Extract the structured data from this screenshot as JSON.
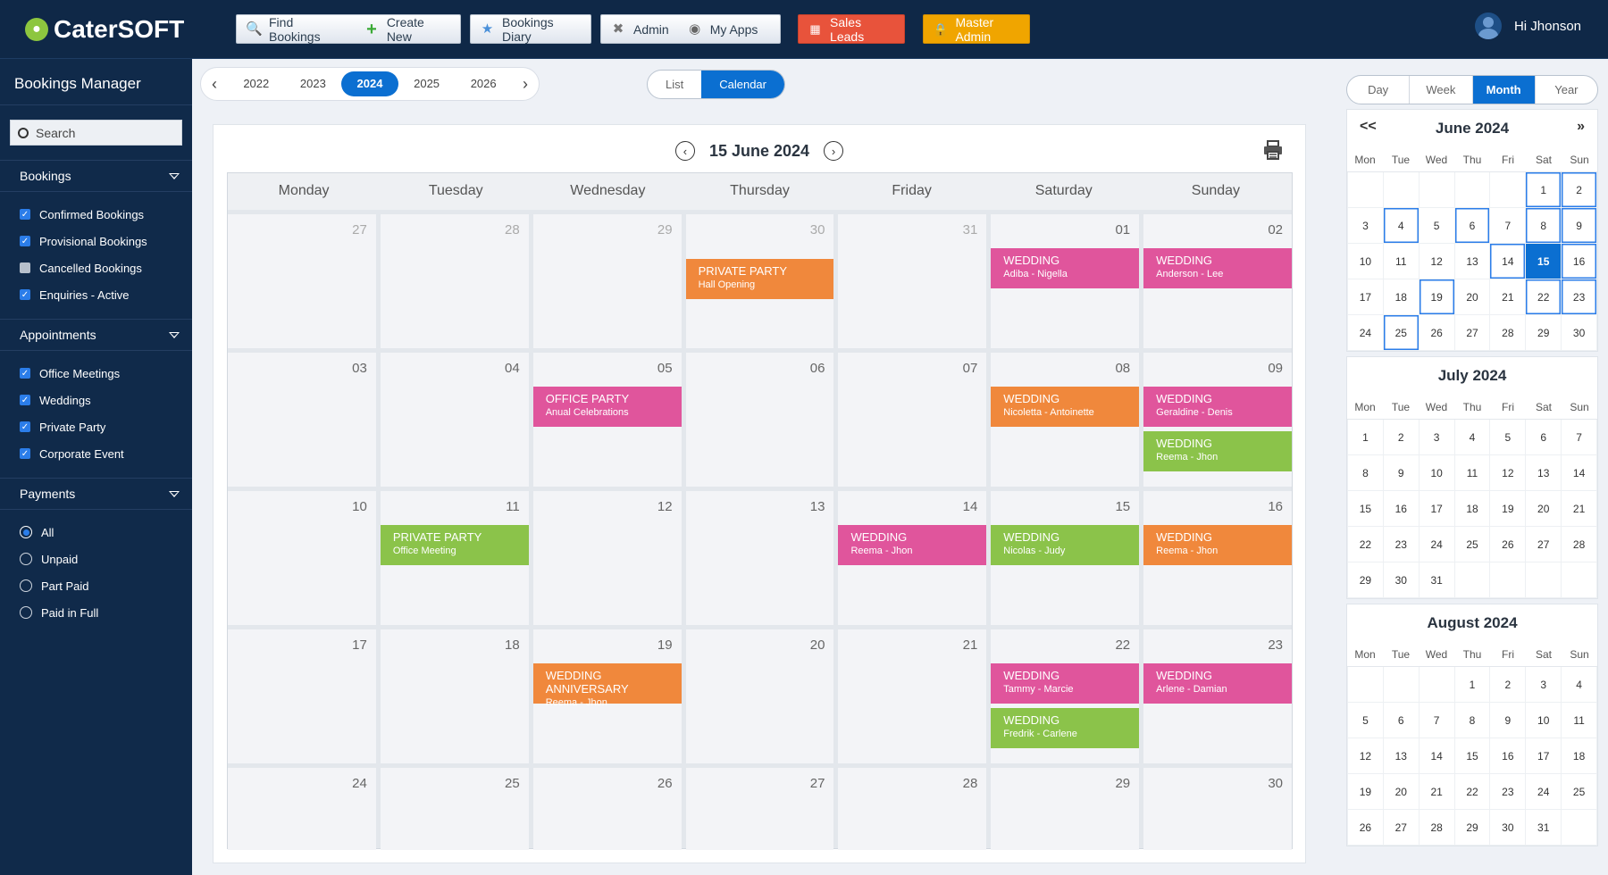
{
  "app": {
    "logo": "CaterSOFT"
  },
  "toolbar": {
    "find": "Find Bookings",
    "create": "Create New",
    "diary": "Bookings Diary",
    "admin": "Admin",
    "apps": "My Apps",
    "sales": "Sales Leads",
    "master": "Master Admin",
    "greeting": "Hi Jhonson"
  },
  "sidebar": {
    "title": "Bookings Manager",
    "search_placeholder": "Search",
    "sections": [
      {
        "label": "Bookings",
        "type": "checkbox",
        "items": [
          {
            "label": "Confirmed Bookings",
            "checked": true
          },
          {
            "label": "Provisional Bookings",
            "checked": true
          },
          {
            "label": "Cancelled Bookings",
            "checked": false
          },
          {
            "label": "Enquiries - Active",
            "checked": true
          }
        ]
      },
      {
        "label": "Appointments",
        "type": "checkbox",
        "items": [
          {
            "label": "Office Meetings",
            "checked": true
          },
          {
            "label": "Weddings",
            "checked": true
          },
          {
            "label": "Private Party",
            "checked": true
          },
          {
            "label": "Corporate Event",
            "checked": true
          }
        ]
      },
      {
        "label": "Payments",
        "type": "radio",
        "items": [
          {
            "label": "All",
            "checked": true
          },
          {
            "label": "Unpaid",
            "checked": false
          },
          {
            "label": "Part Paid",
            "checked": false
          },
          {
            "label": "Paid in Full",
            "checked": false
          }
        ]
      }
    ]
  },
  "years": {
    "list": [
      "2022",
      "2023",
      "2024",
      "2025",
      "2026"
    ],
    "active": "2024"
  },
  "view_toggle": {
    "list": "List",
    "calendar": "Calendar",
    "active": "Calendar"
  },
  "calendar": {
    "title": "15 June 2024",
    "weekdays": [
      "Monday",
      "Tuesday",
      "Wednesday",
      "Thursday",
      "Friday",
      "Saturday",
      "Sunday"
    ],
    "weeks": [
      [
        {
          "day": "27",
          "dim": true,
          "events": []
        },
        {
          "day": "28",
          "dim": true,
          "events": []
        },
        {
          "day": "29",
          "dim": true,
          "events": []
        },
        {
          "day": "30",
          "dim": true,
          "events": [
            {
              "title": "PRIVATE PARTY",
              "sub": "Hall Opening",
              "color": "orange",
              "offset": true
            }
          ]
        },
        {
          "day": "31",
          "dim": true,
          "events": []
        },
        {
          "day": "01",
          "events": [
            {
              "title": "WEDDING",
              "sub": "Adiba  - Nigella",
              "color": "pink"
            }
          ]
        },
        {
          "day": "02",
          "events": [
            {
              "title": "WEDDING",
              "sub": "Anderson - Lee",
              "color": "pink"
            }
          ]
        }
      ],
      [
        {
          "day": "03",
          "events": []
        },
        {
          "day": "04",
          "events": []
        },
        {
          "day": "05",
          "events": [
            {
              "title": "OFFICE PARTY",
              "sub": "Anual Celebrations",
              "color": "pink"
            }
          ]
        },
        {
          "day": "06",
          "events": []
        },
        {
          "day": "07",
          "events": []
        },
        {
          "day": "08",
          "events": [
            {
              "title": "WEDDING",
              "sub": "Nicoletta - Antoinette",
              "color": "orange"
            }
          ]
        },
        {
          "day": "09",
          "events": [
            {
              "title": "WEDDING",
              "sub": "Geraldine - Denis",
              "color": "pink"
            },
            {
              "title": "WEDDING",
              "sub": "Reema - Jhon",
              "color": "green"
            }
          ]
        }
      ],
      [
        {
          "day": "10",
          "events": []
        },
        {
          "day": "11",
          "events": [
            {
              "title": "PRIVATE PARTY",
              "sub": "Office Meeting",
              "color": "green"
            }
          ]
        },
        {
          "day": "12",
          "events": []
        },
        {
          "day": "13",
          "events": []
        },
        {
          "day": "14",
          "events": [
            {
              "title": "WEDDING",
              "sub": "Reema - Jhon",
              "color": "pink"
            }
          ]
        },
        {
          "day": "15",
          "events": [
            {
              "title": "WEDDING",
              "sub": "Nicolas - Judy",
              "color": "green"
            }
          ]
        },
        {
          "day": "16",
          "events": [
            {
              "title": "WEDDING",
              "sub": "Reema - Jhon",
              "color": "orange"
            }
          ]
        }
      ],
      [
        {
          "day": "17",
          "events": []
        },
        {
          "day": "18",
          "events": []
        },
        {
          "day": "19",
          "events": [
            {
              "title": "WEDDING ANNIVERSARY",
              "sub": "Reema - Jhon",
              "color": "orange"
            }
          ]
        },
        {
          "day": "20",
          "events": []
        },
        {
          "day": "21",
          "events": []
        },
        {
          "day": "22",
          "events": [
            {
              "title": "WEDDING",
              "sub": "Tammy - Marcie",
              "color": "pink"
            },
            {
              "title": "WEDDING",
              "sub": "Fredrik - Carlene",
              "color": "green"
            }
          ]
        },
        {
          "day": "23",
          "events": [
            {
              "title": "WEDDING",
              "sub": "Arlene - Damian",
              "color": "pink"
            }
          ]
        }
      ],
      [
        {
          "day": "24",
          "events": []
        },
        {
          "day": "25",
          "events": []
        },
        {
          "day": "26",
          "events": []
        },
        {
          "day": "27",
          "events": []
        },
        {
          "day": "28",
          "events": []
        },
        {
          "day": "29",
          "events": []
        },
        {
          "day": "30",
          "events": []
        }
      ]
    ]
  },
  "right_toggle": {
    "items": [
      "Day",
      "Week",
      "Month",
      "Year"
    ],
    "active": "Month"
  },
  "mini_calendars": [
    {
      "title": "June 2024",
      "nav": true,
      "prev": "<<",
      "next": "»",
      "dow": [
        "Mon",
        "Tue",
        "Wed",
        "Thu",
        "Fri",
        "Sat",
        "Sun"
      ],
      "lead": 5,
      "days": 30,
      "boxed": [
        1,
        2,
        4,
        6,
        8,
        9,
        14,
        16,
        19,
        22,
        23,
        25
      ],
      "selected": 15
    },
    {
      "title": "July 2024",
      "nav": false,
      "dow": [
        "Mon",
        "Tue",
        "Wed",
        "Thu",
        "Fri",
        "Sat",
        "Sun"
      ],
      "lead": 0,
      "days": 31,
      "boxed": [],
      "selected": null
    },
    {
      "title": "August 2024",
      "nav": false,
      "dow": [
        "Mon",
        "Tue",
        "Wed",
        "Thu",
        "Fri",
        "Sat",
        "Sun"
      ],
      "lead": 3,
      "days": 31,
      "boxed": [],
      "selected": null
    }
  ],
  "colors": {
    "orange": "#f0883c",
    "pink": "#e0559c",
    "green": "#8bc34a",
    "accent": "#0b6fd1",
    "navy": "#0f2847"
  }
}
